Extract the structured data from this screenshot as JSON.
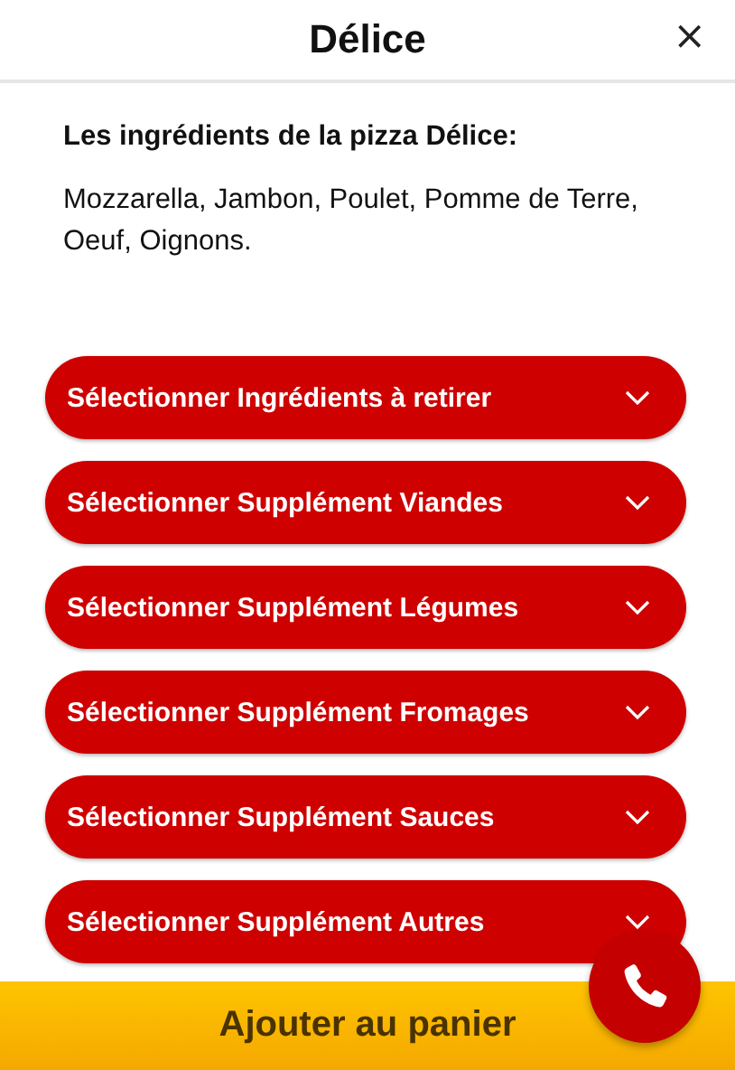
{
  "header": {
    "title": "Délice",
    "close": "×"
  },
  "ingredients": {
    "heading": "Les ingrédients de la pizza Délice:",
    "list": "Mozzarella, Jambon, Poulet, Pomme de Terre, Oeuf, Oignons."
  },
  "dropdowns": [
    {
      "label": "Sélectionner Ingrédients à retirer",
      "expanded": false
    },
    {
      "label": "Sélectionner Supplément Viandes",
      "expanded": false
    },
    {
      "label": "Sélectionner Supplément Légumes",
      "expanded": false
    },
    {
      "label": "Sélectionner Supplément Fromages",
      "expanded": false
    },
    {
      "label": "Sélectionner Supplément Sauces",
      "expanded": false
    },
    {
      "label": "Sélectionner Supplément Autres",
      "expanded": false
    }
  ],
  "cart_button": "Ajouter au panier"
}
